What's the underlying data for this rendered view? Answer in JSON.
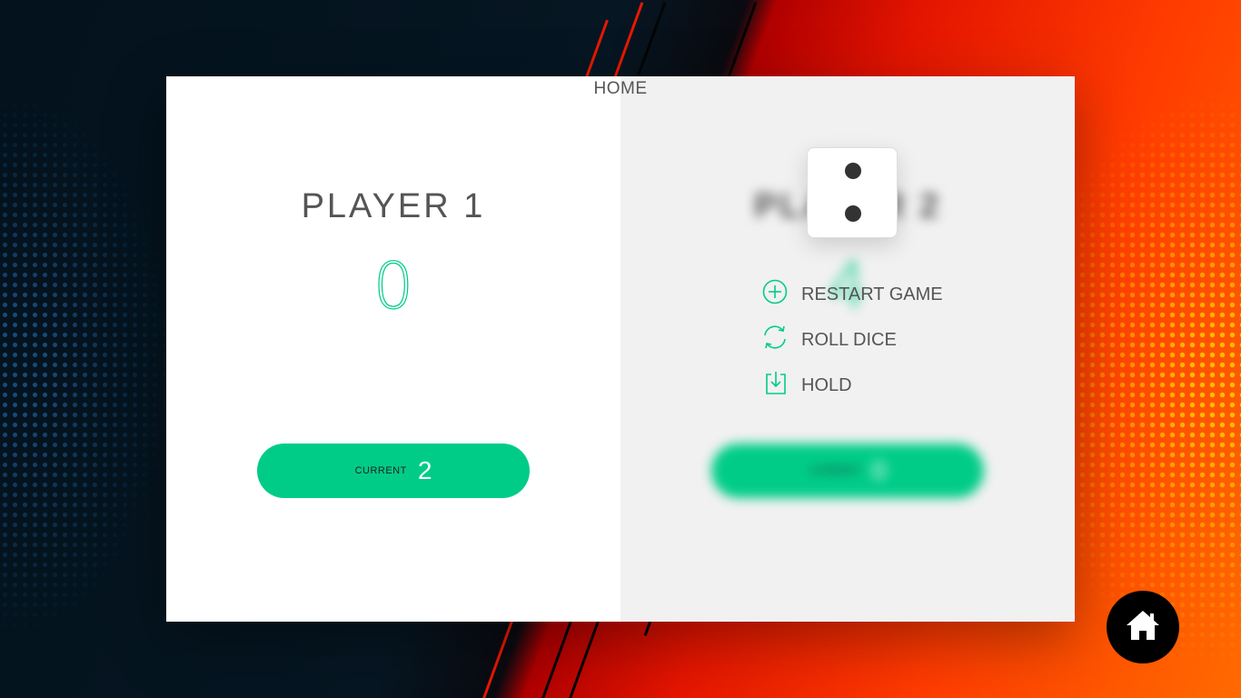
{
  "nav": {
    "home_label": "HOME"
  },
  "players": [
    {
      "name": "PLAYER 1",
      "score": "0",
      "current_label": "CURRENT",
      "current_score": "2",
      "active": true
    },
    {
      "name": "PLAYER 2",
      "score": "4",
      "current_label": "CURRENT",
      "current_score": "0",
      "active": false
    }
  ],
  "dice": {
    "value": 2
  },
  "controls": {
    "new_game": {
      "label": "RESTART GAME",
      "icon": "plus-circle-icon"
    },
    "roll": {
      "label": "ROLL DICE",
      "icon": "refresh-icon"
    },
    "hold": {
      "label": "HOLD",
      "icon": "download-icon"
    }
  },
  "fab": {
    "icon": "home-icon"
  },
  "colors": {
    "accent": "#00cc88",
    "text": "#555555",
    "panel_inactive": "#f1f1f1"
  }
}
